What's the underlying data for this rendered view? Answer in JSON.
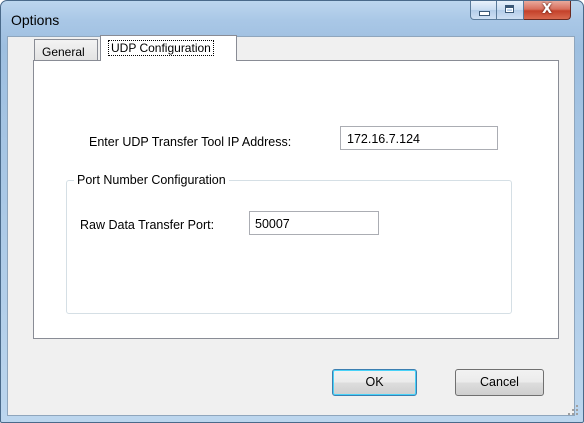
{
  "window": {
    "title": "Options",
    "controls": {
      "minimize_icon": "minimize-icon",
      "maximize_icon": "maximize-icon",
      "close_icon": "close-icon",
      "close_glyph": "X"
    }
  },
  "tabs": [
    {
      "label": "General",
      "selected": false
    },
    {
      "label": "UDP Configuration",
      "selected": true
    }
  ],
  "udp": {
    "ip_label": "Enter UDP Transfer Tool IP Address:",
    "ip_value": "172.16.7.124",
    "port_group_title": "Port Number Configuration",
    "raw_port_label": "Raw Data Transfer Port:",
    "raw_port_value": "50007"
  },
  "buttons": {
    "ok_label": "OK",
    "cancel_label": "Cancel"
  },
  "colors": {
    "titlebar": "#a9c7e6",
    "close_button": "#c4412a",
    "focus_accent": "#3c7fb1"
  }
}
